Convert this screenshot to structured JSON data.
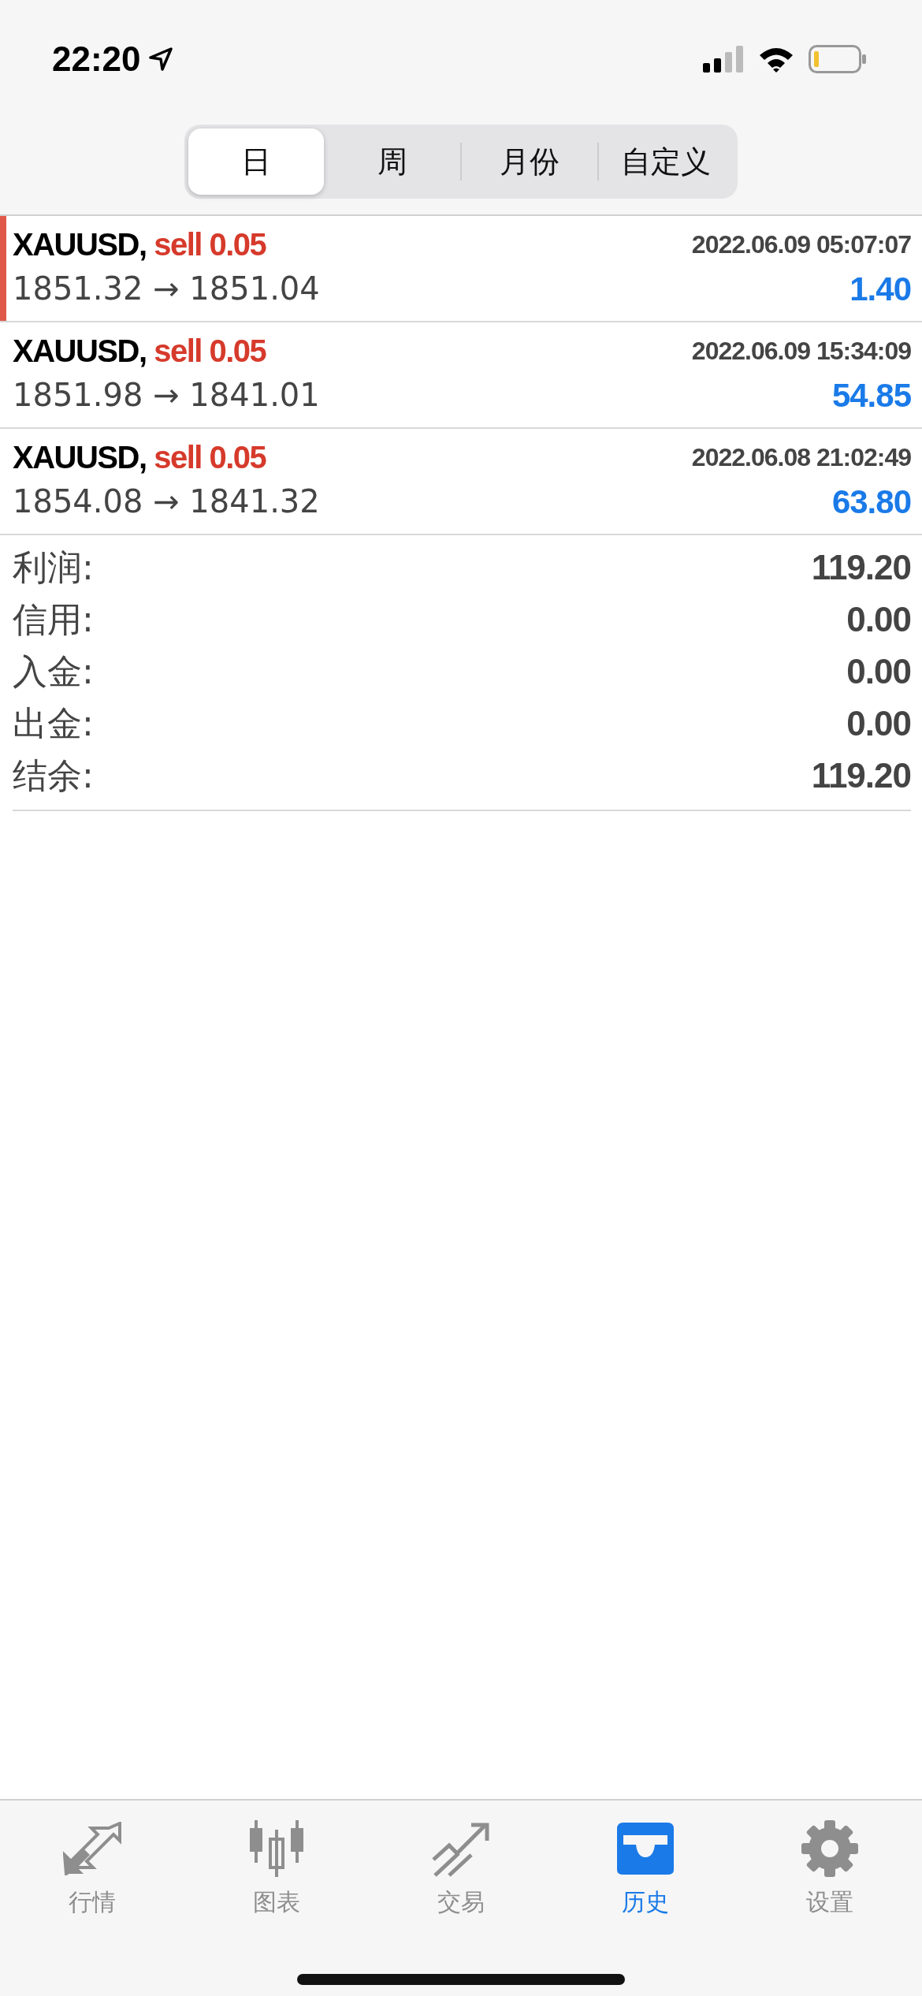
{
  "status_bar": {
    "time": "22:20"
  },
  "periods": [
    {
      "label": "日",
      "selected": true
    },
    {
      "label": "周",
      "selected": false
    },
    {
      "label": "月份",
      "selected": false
    },
    {
      "label": "自定义",
      "selected": false
    }
  ],
  "trades": [
    {
      "symbol": "XAUUSD,",
      "side": "sell 0.05",
      "time": "2022.06.09 05:07:07",
      "prices": "1851.32 → 1851.04",
      "profit": "1.40",
      "selected": true
    },
    {
      "symbol": "XAUUSD,",
      "side": "sell 0.05",
      "time": "2022.06.09 15:34:09",
      "prices": "1851.98 → 1841.01",
      "profit": "54.85",
      "selected": false
    },
    {
      "symbol": "XAUUSD,",
      "side": "sell 0.05",
      "time": "2022.06.08 21:02:49",
      "prices": "1854.08 → 1841.32",
      "profit": "63.80",
      "selected": false
    }
  ],
  "summary": [
    {
      "label": "利润:",
      "value": "119.20"
    },
    {
      "label": "信用:",
      "value": "0.00"
    },
    {
      "label": "入金:",
      "value": "0.00"
    },
    {
      "label": "出金:",
      "value": "0.00"
    },
    {
      "label": "结余:",
      "value": "119.20"
    }
  ],
  "tab_bar": [
    {
      "kind": "quotes",
      "label": "行情",
      "selected": false
    },
    {
      "kind": "chart",
      "label": "图表",
      "selected": false
    },
    {
      "kind": "trade",
      "label": "交易",
      "selected": false
    },
    {
      "kind": "history",
      "label": "历史",
      "selected": true
    },
    {
      "kind": "settings",
      "label": "设置",
      "selected": false
    }
  ]
}
